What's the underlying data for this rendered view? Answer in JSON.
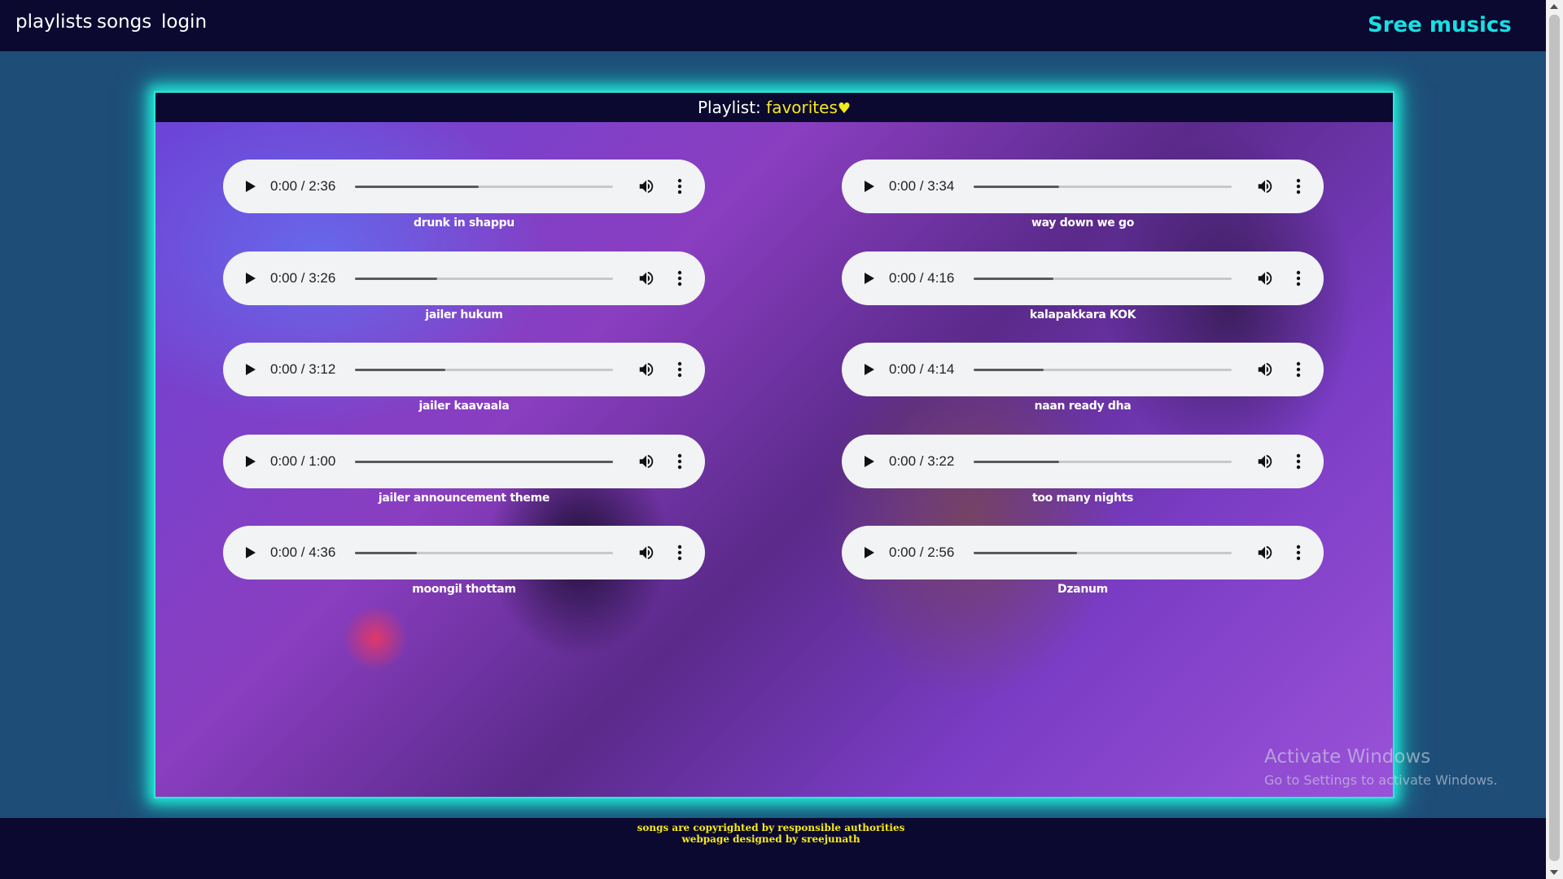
{
  "nav": {
    "links": [
      "playlists",
      "songs",
      "login"
    ],
    "brand": "Sree musics"
  },
  "playlist": {
    "label": "Playlist:",
    "name": "favorites",
    "heart": "♥"
  },
  "songs": [
    {
      "title": "drunk in shappu",
      "time": "0:00 / 2:36",
      "progress": 0.48
    },
    {
      "title": "way down we go",
      "time": "0:00 / 3:34",
      "progress": 0.33
    },
    {
      "title": "jailer hukum",
      "time": "0:00 / 3:26",
      "progress": 0.32
    },
    {
      "title": "kalapakkara KOK",
      "time": "0:00 / 4:16",
      "progress": 0.31
    },
    {
      "title": "jailer kaavaala",
      "time": "0:00 / 3:12",
      "progress": 0.35
    },
    {
      "title": "naan ready dha",
      "time": "0:00 / 4:14",
      "progress": 0.27
    },
    {
      "title": "jailer announcement theme",
      "time": "0:00 / 1:00",
      "progress": 1.0
    },
    {
      "title": "too many nights",
      "time": "0:00 / 3:22",
      "progress": 0.33
    },
    {
      "title": "moongil thottam",
      "time": "0:00 / 4:36",
      "progress": 0.24
    },
    {
      "title": "Dzanum",
      "time": "0:00 / 2:56",
      "progress": 0.4
    }
  ],
  "watermark": {
    "title": "Activate Windows",
    "subtitle": "Go to Settings to activate Windows."
  },
  "footer": {
    "line1": "songs are copyrighted by responsible authorities",
    "line2": "webpage designed by sreejunath"
  },
  "colors": {
    "nav_bg": "#0b0930",
    "page_bg": "#1e4d78",
    "brand": "#16e0e3",
    "accent_yellow": "#f5ea1a",
    "glow": "#2fe6d8"
  },
  "icons": [
    "play-icon",
    "volume-icon",
    "more-options-icon",
    "heart-icon"
  ]
}
